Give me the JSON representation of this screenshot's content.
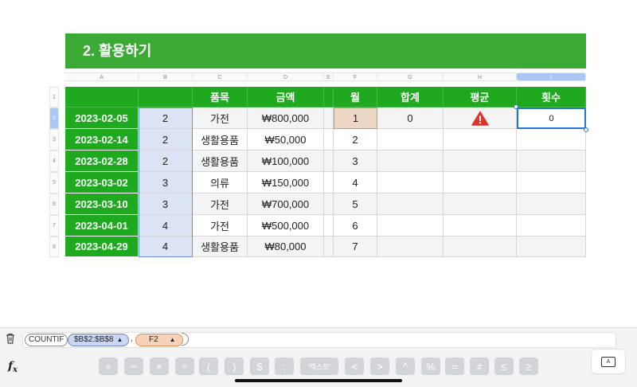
{
  "banner": {
    "title": "2. 활용하기"
  },
  "columns": [
    "A",
    "B",
    "C",
    "D",
    "E",
    "F",
    "G",
    "H",
    "I"
  ],
  "rows": [
    "1",
    "2",
    "3",
    "4",
    "5",
    "6",
    "7",
    "8"
  ],
  "header": {
    "a": "",
    "b": "",
    "c": "품목",
    "d": "금액",
    "e": "",
    "f": "월",
    "g": "합계",
    "h": "평균",
    "i": "횟수"
  },
  "data": [
    {
      "date": "2023-02-05",
      "b": "2",
      "item": "가전",
      "amount": "₩800,000",
      "month": "1",
      "sum": "0",
      "avg": "",
      "count": "0"
    },
    {
      "date": "2023-02-14",
      "b": "2",
      "item": "생활용품",
      "amount": "₩50,000",
      "month": "2",
      "sum": "",
      "avg": "",
      "count": ""
    },
    {
      "date": "2023-02-28",
      "b": "2",
      "item": "생활용품",
      "amount": "₩100,000",
      "month": "3",
      "sum": "",
      "avg": "",
      "count": ""
    },
    {
      "date": "2023-03-02",
      "b": "3",
      "item": "의류",
      "amount": "₩150,000",
      "month": "4",
      "sum": "",
      "avg": "",
      "count": ""
    },
    {
      "date": "2023-03-10",
      "b": "3",
      "item": "가전",
      "amount": "₩700,000",
      "month": "5",
      "sum": "",
      "avg": "",
      "count": ""
    },
    {
      "date": "2023-04-01",
      "b": "4",
      "item": "가전",
      "amount": "₩500,000",
      "month": "6",
      "sum": "",
      "avg": "",
      "count": ""
    },
    {
      "date": "2023-04-29",
      "b": "4",
      "item": "생활용품",
      "amount": "₩80,000",
      "month": "7",
      "sum": "",
      "avg": "",
      "count": ""
    }
  ],
  "formula": {
    "function": "COUNTIF",
    "ref1": "$B$2:$B$8",
    "ref2": "F2",
    "separator": ","
  },
  "icons": {
    "trash": "trash-icon",
    "fx": "fx-icon",
    "warning": "warning-icon",
    "keyboard": "keyboard-icon"
  },
  "keys": [
    "+",
    "−",
    "×",
    "÷",
    "(",
    ")",
    "$",
    ":",
    "'텍스트'",
    "<",
    ">",
    "^",
    "%",
    "=",
    "≠",
    "≤",
    "≥"
  ],
  "colors": {
    "accent_green": "#3aaa35",
    "header_green": "#1fa91f",
    "selection_blue": "#2a74d6",
    "warning_red": "#e0342b"
  }
}
